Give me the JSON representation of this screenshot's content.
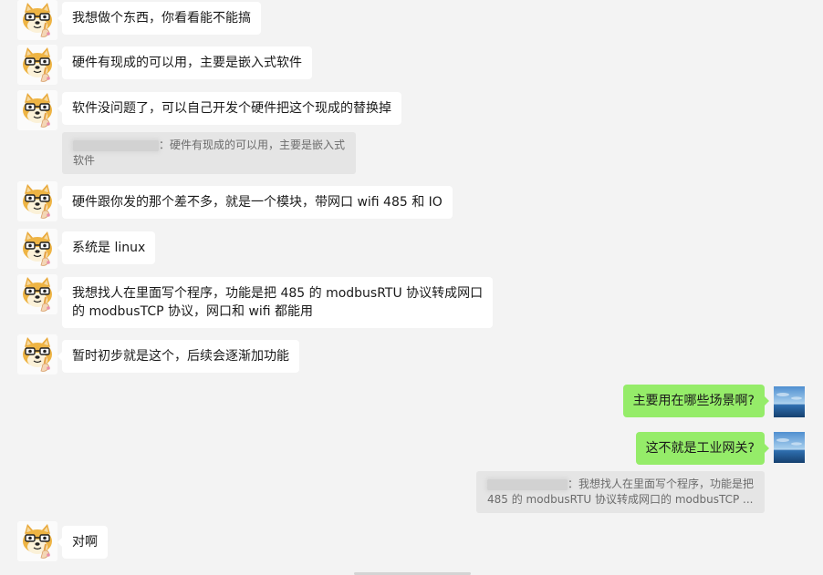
{
  "messages": [
    {
      "side": "left",
      "text": "我想做个东西，你看看能不能搞"
    },
    {
      "side": "left",
      "text": "硬件有现成的可以用，主要是嵌入式软件"
    },
    {
      "side": "left",
      "text": "软件没问题了，可以自己开发个硬件把这个现成的替换掉"
    },
    {
      "side": "quote",
      "line1": "：硬件有现成的可以用，主要是嵌入式",
      "line2": "软件"
    },
    {
      "side": "left",
      "text": "硬件跟你发的那个差不多，就是一个模块，带网口 wifi 485 和 IO"
    },
    {
      "side": "left",
      "text": "系统是 linux"
    },
    {
      "side": "left",
      "line1": "我想找人在里面写个程序，功能是把 485 的 modbusRTU 协议转成网口",
      "line2": "的 modbusTCP 协议，网口和 wifi 都能用"
    },
    {
      "side": "left",
      "text": "暂时初步就是这个，后续会逐渐加功能"
    },
    {
      "side": "right",
      "text": "主要用在哪些场景啊?"
    },
    {
      "side": "right",
      "text": "这不就是工业网关?"
    },
    {
      "side": "quote",
      "line1": "：我想找人在里面写个程序，功能是把",
      "line2": "485 的 modbusRTU 协议转成网口的 modbusTCP ..."
    },
    {
      "side": "left",
      "text": "对啊"
    }
  ],
  "colors": {
    "background": "#f3f3f3",
    "left_bubble": "#ffffff",
    "right_bubble": "#95ec69",
    "quote_bg": "#e5e5e5"
  },
  "avatars": {
    "left": "shiba-doge-avatar",
    "right": "ocean-sky-avatar"
  }
}
